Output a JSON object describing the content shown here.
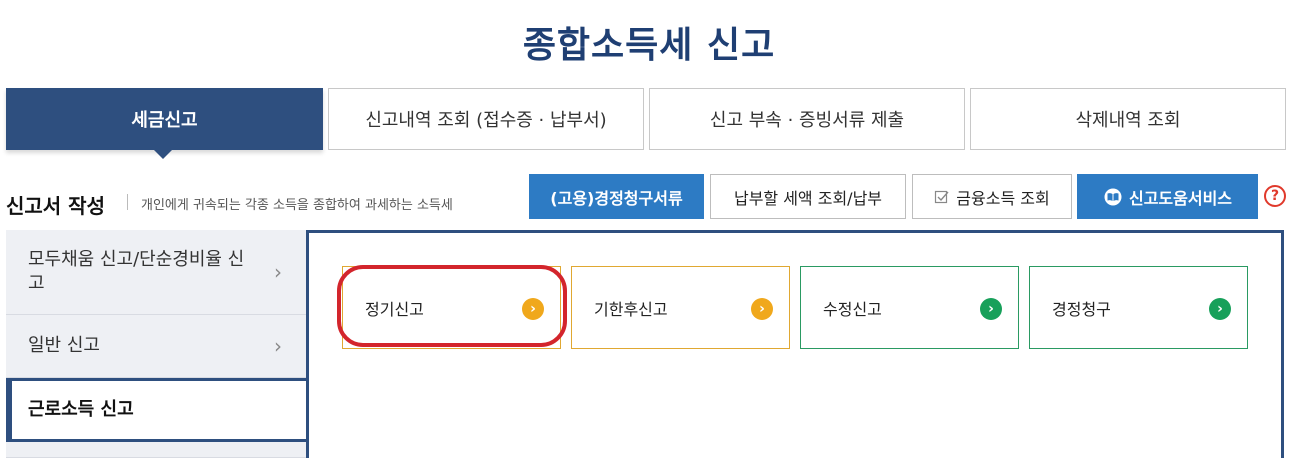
{
  "page": {
    "title": "종합소득세 신고"
  },
  "tabs": [
    {
      "label": "세금신고",
      "active": true
    },
    {
      "label": "신고내역 조회 (접수증 · 납부서)",
      "active": false
    },
    {
      "label": "신고 부속 · 증빙서류 제출",
      "active": false
    },
    {
      "label": "삭제내역 조회",
      "active": false
    }
  ],
  "section": {
    "title": "신고서 작성",
    "description": "개인에게 귀속되는 각종 소득을 종합하여 과세하는 소득세"
  },
  "actions": {
    "claim_docs": "(고용)경정청구서류",
    "payable_tax": "납부할 세액 조회/납부",
    "financial_income": "금융소득 조회",
    "filing_help": "신고도움서비스",
    "help_symbol": "?"
  },
  "side_nav": [
    {
      "label": "모두채움 신고/단순경비율 신고",
      "chevron": "›",
      "active": false
    },
    {
      "label": "일반 신고",
      "chevron": "›",
      "active": false
    },
    {
      "label": "근로소득 신고",
      "active": true
    }
  ],
  "cards": [
    {
      "label": "정기신고",
      "color": "orange",
      "arrow": "›"
    },
    {
      "label": "기한후신고",
      "color": "orange",
      "arrow": "›"
    },
    {
      "label": "수정신고",
      "color": "green",
      "arrow": "›"
    },
    {
      "label": "경정청구",
      "color": "green",
      "arrow": "›"
    }
  ],
  "colors": {
    "navy": "#2e4f7f",
    "blue": "#2d7bc4",
    "orange": "#f0a81c",
    "green": "#17a05a",
    "highlight_red": "#d3252c"
  }
}
